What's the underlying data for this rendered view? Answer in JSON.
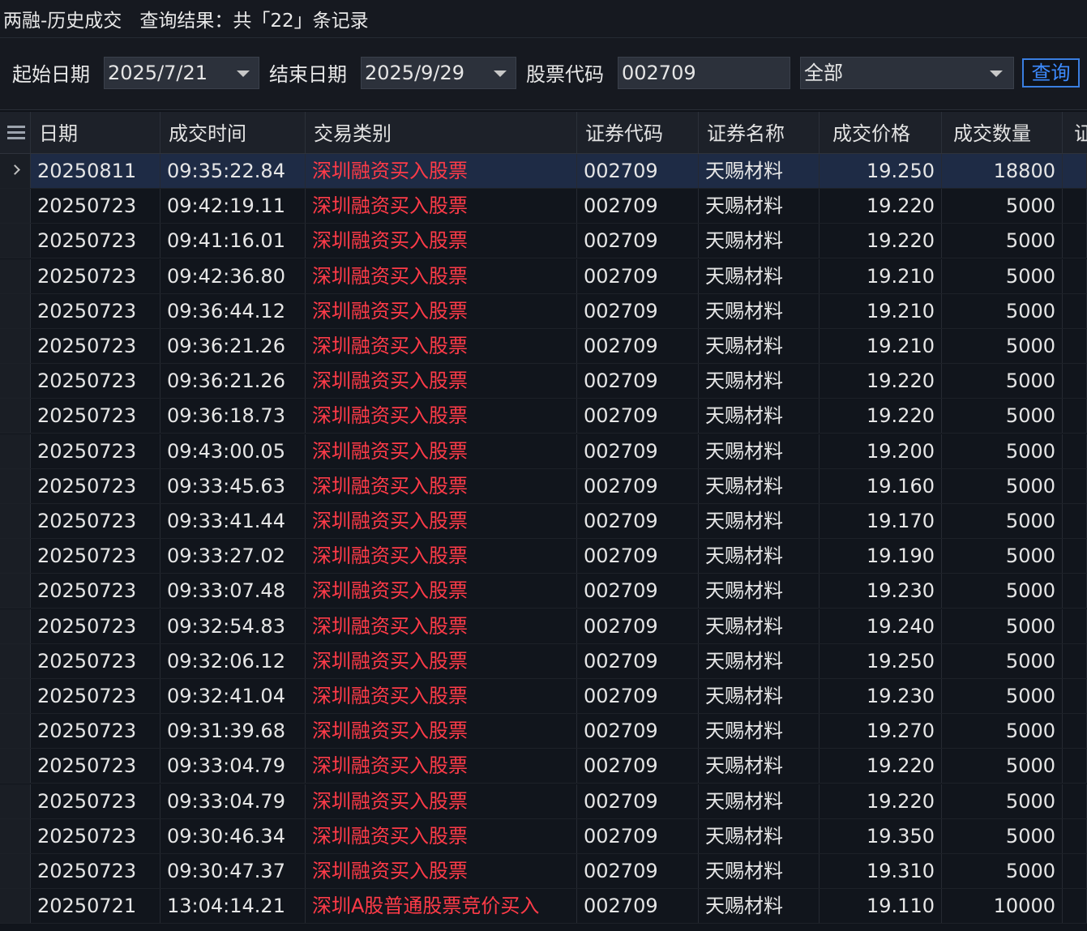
{
  "title": {
    "module": "两融-历史成交",
    "result": "查询结果：共「22」条记录"
  },
  "filters": {
    "start_label": "起始日期",
    "start_value": "2025/7/21",
    "end_label": "结束日期",
    "end_value": "2025/9/29",
    "code_label": "股票代码",
    "code_value": "002709",
    "type_value": "全部",
    "query_button": "查询"
  },
  "table": {
    "columns": [
      "日期",
      "成交时间",
      "交易类别",
      "证券代码",
      "证券名称",
      "成交价格",
      "成交数量",
      "证"
    ],
    "rows": [
      [
        "20250811",
        "09:35:22.84",
        "深圳融资买入股票",
        "002709",
        "天赐材料",
        "19.250",
        "18800"
      ],
      [
        "20250723",
        "09:42:19.11",
        "深圳融资买入股票",
        "002709",
        "天赐材料",
        "19.220",
        "5000"
      ],
      [
        "20250723",
        "09:41:16.01",
        "深圳融资买入股票",
        "002709",
        "天赐材料",
        "19.220",
        "5000"
      ],
      [
        "20250723",
        "09:42:36.80",
        "深圳融资买入股票",
        "002709",
        "天赐材料",
        "19.210",
        "5000"
      ],
      [
        "20250723",
        "09:36:44.12",
        "深圳融资买入股票",
        "002709",
        "天赐材料",
        "19.210",
        "5000"
      ],
      [
        "20250723",
        "09:36:21.26",
        "深圳融资买入股票",
        "002709",
        "天赐材料",
        "19.210",
        "5000"
      ],
      [
        "20250723",
        "09:36:21.26",
        "深圳融资买入股票",
        "002709",
        "天赐材料",
        "19.220",
        "5000"
      ],
      [
        "20250723",
        "09:36:18.73",
        "深圳融资买入股票",
        "002709",
        "天赐材料",
        "19.220",
        "5000"
      ],
      [
        "20250723",
        "09:43:00.05",
        "深圳融资买入股票",
        "002709",
        "天赐材料",
        "19.200",
        "5000"
      ],
      [
        "20250723",
        "09:33:45.63",
        "深圳融资买入股票",
        "002709",
        "天赐材料",
        "19.160",
        "5000"
      ],
      [
        "20250723",
        "09:33:41.44",
        "深圳融资买入股票",
        "002709",
        "天赐材料",
        "19.170",
        "5000"
      ],
      [
        "20250723",
        "09:33:27.02",
        "深圳融资买入股票",
        "002709",
        "天赐材料",
        "19.190",
        "5000"
      ],
      [
        "20250723",
        "09:33:07.48",
        "深圳融资买入股票",
        "002709",
        "天赐材料",
        "19.230",
        "5000"
      ],
      [
        "20250723",
        "09:32:54.83",
        "深圳融资买入股票",
        "002709",
        "天赐材料",
        "19.240",
        "5000"
      ],
      [
        "20250723",
        "09:32:06.12",
        "深圳融资买入股票",
        "002709",
        "天赐材料",
        "19.250",
        "5000"
      ],
      [
        "20250723",
        "09:32:41.04",
        "深圳融资买入股票",
        "002709",
        "天赐材料",
        "19.230",
        "5000"
      ],
      [
        "20250723",
        "09:31:39.68",
        "深圳融资买入股票",
        "002709",
        "天赐材料",
        "19.270",
        "5000"
      ],
      [
        "20250723",
        "09:33:04.79",
        "深圳融资买入股票",
        "002709",
        "天赐材料",
        "19.220",
        "5000"
      ],
      [
        "20250723",
        "09:33:04.79",
        "深圳融资买入股票",
        "002709",
        "天赐材料",
        "19.220",
        "5000"
      ],
      [
        "20250723",
        "09:30:46.34",
        "深圳融资买入股票",
        "002709",
        "天赐材料",
        "19.350",
        "5000"
      ],
      [
        "20250723",
        "09:30:47.37",
        "深圳融资买入股票",
        "002709",
        "天赐材料",
        "19.310",
        "5000"
      ],
      [
        "20250721",
        "13:04:14.21",
        "深圳A股普通股票竞价买入",
        "002709",
        "天赐材料",
        "19.110",
        "10000"
      ]
    ],
    "selected_row": 0
  },
  "colors": {
    "trade_type": "#ff3b48",
    "selected_row": "#1e2b45",
    "query_button": "#3d8bff"
  }
}
